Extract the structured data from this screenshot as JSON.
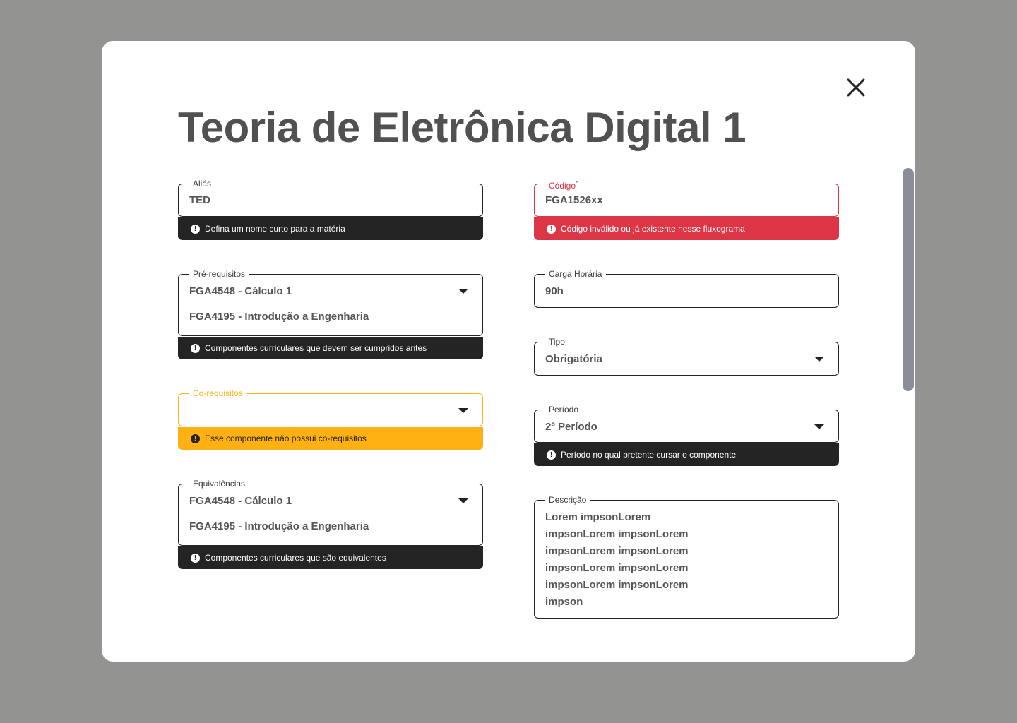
{
  "modal": {
    "title": "Teoria de Eletrônica Digital 1",
    "close_icon": "close-icon"
  },
  "fields": {
    "alias": {
      "label": "Aliás",
      "value": "TED",
      "helper": "Defina um nome curto para a matéria"
    },
    "codigo": {
      "label": "Código",
      "required_mark": "*",
      "value": "FGA1526xx",
      "helper": "Código inválido ou já existente nesse fluxograma"
    },
    "pre_requisitos": {
      "label": "Pré-requisitos",
      "items": [
        "FGA4548 - Cálculo 1",
        "FGA4195 - Introdução a Engenharia"
      ],
      "helper": "Componentes curriculares que devem ser cumpridos antes"
    },
    "carga_horaria": {
      "label": "Carga Horária",
      "value": "90h"
    },
    "tipo": {
      "label": "Tipo",
      "value": "Obrigatória"
    },
    "co_requisitos": {
      "label": "Co-requisitos",
      "value": "",
      "helper": "Esse componente não possui co-requisitos"
    },
    "periodo": {
      "label": "Período",
      "value": "2º Período",
      "helper": "Período no qual pretente cursar o componente"
    },
    "equivalencias": {
      "label": "Equivalências",
      "items": [
        "FGA4548 - Cálculo 1",
        "FGA4195 - Introdução a Engenharia"
      ],
      "helper": "Componentes curriculares que são equivalentes"
    },
    "descricao": {
      "label": "Descrição",
      "value": "Lorem impsonLorem\nimpsonLorem impsonLorem\nimpsonLorem impsonLorem\nimpsonLorem impsonLorem\nimpsonLorem impsonLorem\nimpson"
    }
  },
  "colors": {
    "backdrop": "#939392",
    "error": "#dc3545",
    "warning": "#ffb012",
    "helper_dark": "#242424",
    "scrollbar": "#8b8d99"
  }
}
